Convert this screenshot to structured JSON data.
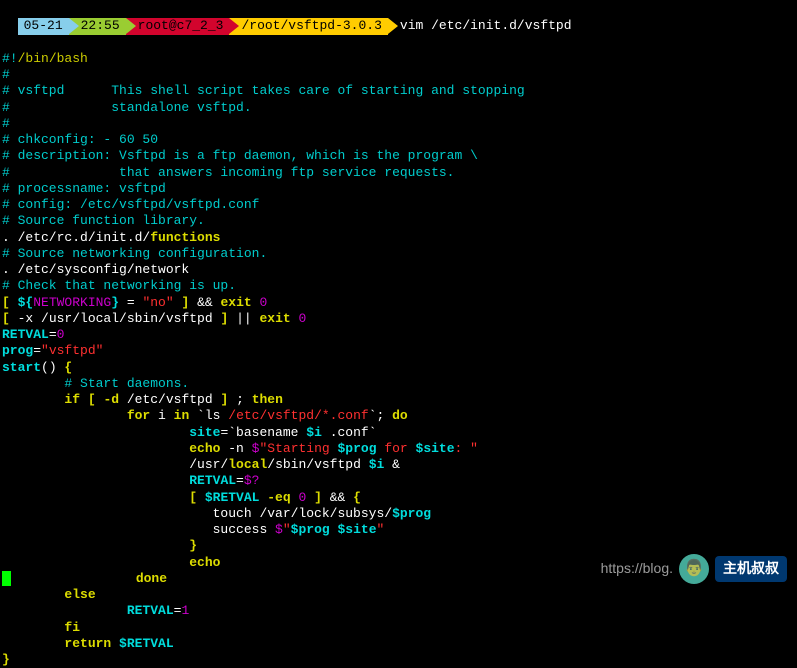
{
  "prompt": {
    "date": "05-21",
    "time": "22:55",
    "user_host": "root@c7_2_3",
    "cwd": "/root/vsftpd-3.0.3",
    "command": "vim /etc/init.d/vsftpd"
  },
  "code": {
    "l01a": "#!",
    "l01b": "/bin/bash",
    "l02": "#",
    "l03": "# vsftpd      This shell script takes care of starting and stopping",
    "l04": "#             standalone vsftpd.",
    "l05": "#",
    "l06": "# chkconfig: - 60 50",
    "l07": "# description: Vsftpd is a ftp daemon, which is the program \\",
    "l08": "#              that answers incoming ftp service requests.",
    "l09": "# processname: vsftpd",
    "l10": "# config: /etc/vsftpd/vsftpd.conf",
    "l11": "# Source function library.",
    "l12a": ". /etc/rc.d/init.d/",
    "l12b": "functions",
    "l13": "# Source networking configuration.",
    "l14a": ". /etc/sysconfig/network",
    "l15": "# Check that networking is up.",
    "l16a": "[",
    "l16b": " ${",
    "l16c": "NETWORKING",
    "l16d": "}",
    "l16e": " = ",
    "l16f": "\"no\"",
    "l16g": " ] ",
    "l16h": "&&",
    "l16i": " exit ",
    "l16j": "0",
    "l17a": "[",
    "l17b": " -x /usr/local/sbin/vsftpd ",
    "l17c": "]",
    "l17d": " ",
    "l17e": "||",
    "l17f": " exit ",
    "l17g": "0",
    "l18a": "RETVAL",
    "l18b": "=",
    "l18c": "0",
    "l19a": "prog",
    "l19b": "=",
    "l19c": "\"vsftpd\"",
    "l20a": "start",
    "l20b": "()",
    "l20c": " {",
    "l21": "        # Start daemons.",
    "l22a": "        ",
    "l22b": "if",
    "l22c": " [ ",
    "l22d": "-d",
    "l22e": " /etc/vsftpd ",
    "l22f": "]",
    "l22g": " ; ",
    "l22h": "then",
    "l23a": "                ",
    "l23b": "for",
    "l23c": " i ",
    "l23d": "in",
    "l23e": " `ls ",
    "l23f": "/etc/vsftpd/*.conf",
    "l23g": "`; ",
    "l23h": "do",
    "l24a": "                        ",
    "l24b": "site",
    "l24c": "=`basename ",
    "l24d": "$i",
    "l24e": " .conf`",
    "l25a": "                        ",
    "l25b": "echo",
    "l25c": " -n ",
    "l25d": "$",
    "l25e": "\"Starting ",
    "l25f": "$prog",
    "l25g": " for ",
    "l25h": "$site",
    "l25i": ": \"",
    "l26a": "                        /usr/",
    "l26b": "local",
    "l26c": "/sbin/vsftpd ",
    "l26d": "$i",
    "l26e": " &",
    "l27a": "                        ",
    "l27b": "RETVAL",
    "l27c": "=",
    "l27d": "$?",
    "l28a": "                        [ ",
    "l28b": "$RETVAL",
    "l28c": " -eq ",
    "l28d": "0",
    "l28e": " ] ",
    "l28f": "&&",
    "l28g": " {",
    "l29a": "                           touch /var/lock/subsys/",
    "l29b": "$prog",
    "l30a": "                           success ",
    "l30b": "$",
    "l30c": "\"",
    "l30d": "$prog",
    "l30e": " ",
    "l30f": "$site",
    "l30g": "\"",
    "l31": "                        }",
    "l32a": "                        ",
    "l32b": "echo",
    "l33a": "                ",
    "l33b": "done",
    "l34a": "        ",
    "l34b": "else",
    "l35a": "                ",
    "l35b": "RETVAL",
    "l35c": "=",
    "l35d": "1",
    "l36a": "        ",
    "l36b": "fi",
    "l37a": "        ",
    "l37b": "return",
    "l37c": " ",
    "l37d": "$RETVAL",
    "l38": "}"
  },
  "watermark": {
    "url": "https://blog.",
    "text": "主机叔叔"
  }
}
